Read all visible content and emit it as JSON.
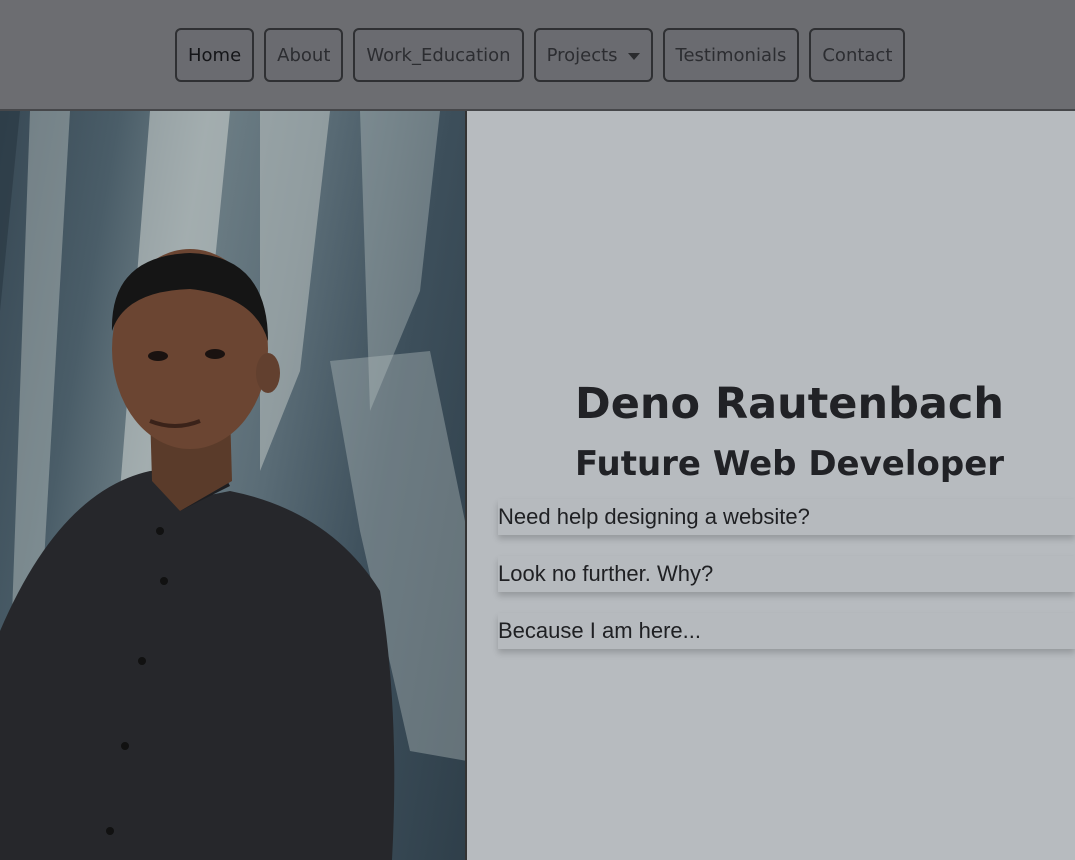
{
  "nav": {
    "items": [
      {
        "label": "Home"
      },
      {
        "label": "About"
      },
      {
        "label": "Work_Education"
      },
      {
        "label": "Projects"
      },
      {
        "label": "Testimonials"
      },
      {
        "label": "Contact"
      }
    ]
  },
  "hero": {
    "name": "Deno Rautenbach",
    "role": "Future Web Developer",
    "lines": [
      "Need help designing a website?",
      "Look no further. Why?",
      "Because I am here..."
    ]
  },
  "colors": {
    "navbar": "#6c6d71",
    "panel": "#b7bbbf",
    "text": "#212226"
  }
}
